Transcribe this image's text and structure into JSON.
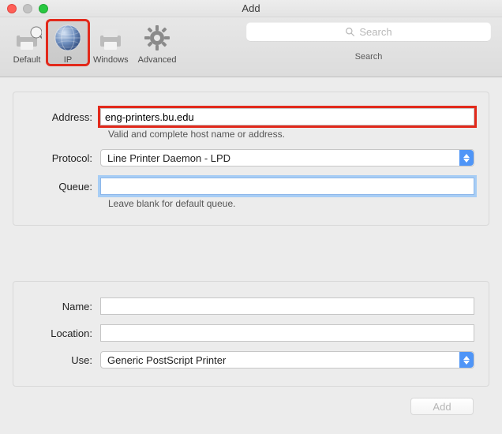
{
  "window": {
    "title": "Add"
  },
  "toolbar": {
    "items": [
      {
        "id": "default",
        "label": "Default"
      },
      {
        "id": "ip",
        "label": "IP"
      },
      {
        "id": "windows",
        "label": "Windows"
      },
      {
        "id": "advanced",
        "label": "Advanced"
      }
    ],
    "selected": "ip"
  },
  "search": {
    "placeholder": "Search",
    "caption": "Search"
  },
  "form_top": {
    "address_label": "Address:",
    "address_value": "eng-printers.bu.edu",
    "address_hint": "Valid and complete host name or address.",
    "protocol_label": "Protocol:",
    "protocol_value": "Line Printer Daemon - LPD",
    "queue_label": "Queue:",
    "queue_value": "",
    "queue_hint": "Leave blank for default queue."
  },
  "form_bottom": {
    "name_label": "Name:",
    "name_value": "",
    "location_label": "Location:",
    "location_value": "",
    "use_label": "Use:",
    "use_value": "Generic PostScript Printer"
  },
  "footer": {
    "add_label": "Add"
  }
}
